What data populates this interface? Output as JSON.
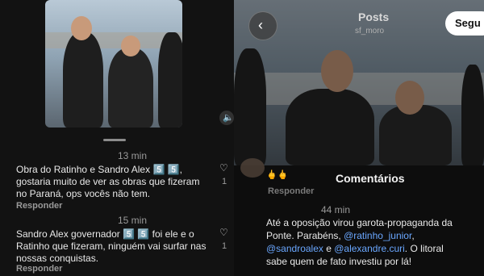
{
  "left": {
    "comments": [
      {
        "time": "13 min",
        "text_line1": "Obra do Ratinho e Sandro Alex 5️⃣ 5️⃣,",
        "text_line2": "gostaria muito de ver as obras que fizeram",
        "text_line3": "no Paraná, ops vocês não tem.",
        "likes": "1",
        "reply_label": "Responder"
      },
      {
        "time": "15 min",
        "text_line1": "Sandro Alex governador 5️⃣ 5️⃣ foi ele e o",
        "text_line2": "Ratinho que fizeram, ninguém vai surfar nas",
        "text_line3": "nossas conquistas.",
        "likes": "1",
        "reply_label": "Responder"
      }
    ]
  },
  "right": {
    "header": {
      "title": "Posts",
      "subtitle": "sf_moro",
      "follow_label": "Segu"
    },
    "top_reply_label": "Responder",
    "comments_title": "Comentários",
    "comment": {
      "time": "44 min",
      "line1": "Até a oposição virou garota-propaganda da",
      "line2": "Ponte. Parabéns,",
      "mention1": "@ratinho_junior",
      "line2_end": ",",
      "mention2": "@sandroalex",
      "mid": " e ",
      "mention3": "@alexandre.curi",
      "line3_end": ". O litoral",
      "line4": "sabe quem de fato investiu por lá!"
    }
  }
}
